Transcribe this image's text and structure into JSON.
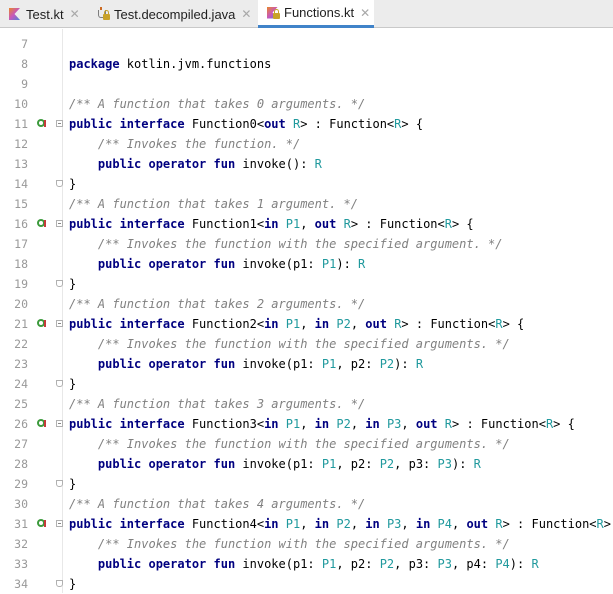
{
  "tabs": [
    {
      "label": "Test.kt",
      "icon": "kotlin-file-icon",
      "active": false
    },
    {
      "label": "Test.decompiled.java",
      "icon": "java-file-icon",
      "active": false
    },
    {
      "label": "Functions.kt",
      "icon": "kotlin-file-icon",
      "active": true
    }
  ],
  "close_glyph": "✕",
  "colors": {
    "keyword": "#000080",
    "comment": "#808080",
    "type_param": "#20999d",
    "gutter_icon": "#3c9a3c",
    "tab_underline": "#4083c9"
  },
  "lines": [
    {
      "n": "7",
      "tokens": []
    },
    {
      "n": "8",
      "tokens": [
        [
          "kw",
          "package"
        ],
        [
          "pl",
          " kotlin.jvm.functions"
        ]
      ]
    },
    {
      "n": "9",
      "tokens": []
    },
    {
      "n": "10",
      "tokens": [
        [
          "cm",
          "/** A function that takes 0 arguments. */"
        ]
      ]
    },
    {
      "n": "11",
      "impl": true,
      "fold": "open",
      "tokens": [
        [
          "kw",
          "public interface"
        ],
        [
          "pl",
          " Function0<"
        ],
        [
          "kw",
          "out"
        ],
        [
          "pl",
          " "
        ],
        [
          "tp",
          "R"
        ],
        [
          "pl",
          "> : Function<"
        ],
        [
          "tp",
          "R"
        ],
        [
          "pl",
          "> {"
        ]
      ]
    },
    {
      "n": "12",
      "tokens": [
        [
          "pl",
          "    "
        ],
        [
          "cm",
          "/** Invokes the function. */"
        ]
      ]
    },
    {
      "n": "13",
      "tokens": [
        [
          "pl",
          "    "
        ],
        [
          "kw",
          "public operator fun"
        ],
        [
          "pl",
          " invoke(): "
        ],
        [
          "tp",
          "R"
        ]
      ]
    },
    {
      "n": "14",
      "fold": "close",
      "tokens": [
        [
          "pl",
          "}"
        ]
      ]
    },
    {
      "n": "15",
      "tokens": [
        [
          "cm",
          "/** A function that takes 1 argument. */"
        ]
      ]
    },
    {
      "n": "16",
      "impl": true,
      "fold": "open",
      "tokens": [
        [
          "kw",
          "public interface"
        ],
        [
          "pl",
          " Function1<"
        ],
        [
          "kw",
          "in"
        ],
        [
          "pl",
          " "
        ],
        [
          "tp",
          "P1"
        ],
        [
          "pl",
          ", "
        ],
        [
          "kw",
          "out"
        ],
        [
          "pl",
          " "
        ],
        [
          "tp",
          "R"
        ],
        [
          "pl",
          "> : Function<"
        ],
        [
          "tp",
          "R"
        ],
        [
          "pl",
          "> {"
        ]
      ]
    },
    {
      "n": "17",
      "tokens": [
        [
          "pl",
          "    "
        ],
        [
          "cm",
          "/** Invokes the function with the specified argument. */"
        ]
      ]
    },
    {
      "n": "18",
      "tokens": [
        [
          "pl",
          "    "
        ],
        [
          "kw",
          "public operator fun"
        ],
        [
          "pl",
          " invoke(p1: "
        ],
        [
          "tp",
          "P1"
        ],
        [
          "pl",
          "): "
        ],
        [
          "tp",
          "R"
        ]
      ]
    },
    {
      "n": "19",
      "fold": "close",
      "tokens": [
        [
          "pl",
          "}"
        ]
      ]
    },
    {
      "n": "20",
      "tokens": [
        [
          "cm",
          "/** A function that takes 2 arguments. */"
        ]
      ]
    },
    {
      "n": "21",
      "impl": true,
      "fold": "open",
      "tokens": [
        [
          "kw",
          "public interface"
        ],
        [
          "pl",
          " Function2<"
        ],
        [
          "kw",
          "in"
        ],
        [
          "pl",
          " "
        ],
        [
          "tp",
          "P1"
        ],
        [
          "pl",
          ", "
        ],
        [
          "kw",
          "in"
        ],
        [
          "pl",
          " "
        ],
        [
          "tp",
          "P2"
        ],
        [
          "pl",
          ", "
        ],
        [
          "kw",
          "out"
        ],
        [
          "pl",
          " "
        ],
        [
          "tp",
          "R"
        ],
        [
          "pl",
          "> : Function<"
        ],
        [
          "tp",
          "R"
        ],
        [
          "pl",
          "> {"
        ]
      ]
    },
    {
      "n": "22",
      "tokens": [
        [
          "pl",
          "    "
        ],
        [
          "cm",
          "/** Invokes the function with the specified arguments. */"
        ]
      ]
    },
    {
      "n": "23",
      "tokens": [
        [
          "pl",
          "    "
        ],
        [
          "kw",
          "public operator fun"
        ],
        [
          "pl",
          " invoke(p1: "
        ],
        [
          "tp",
          "P1"
        ],
        [
          "pl",
          ", p2: "
        ],
        [
          "tp",
          "P2"
        ],
        [
          "pl",
          "): "
        ],
        [
          "tp",
          "R"
        ]
      ]
    },
    {
      "n": "24",
      "fold": "close",
      "tokens": [
        [
          "pl",
          "}"
        ]
      ]
    },
    {
      "n": "25",
      "tokens": [
        [
          "cm",
          "/** A function that takes 3 arguments. */"
        ]
      ]
    },
    {
      "n": "26",
      "impl": true,
      "fold": "open",
      "tokens": [
        [
          "kw",
          "public interface"
        ],
        [
          "pl",
          " Function3<"
        ],
        [
          "kw",
          "in"
        ],
        [
          "pl",
          " "
        ],
        [
          "tp",
          "P1"
        ],
        [
          "pl",
          ", "
        ],
        [
          "kw",
          "in"
        ],
        [
          "pl",
          " "
        ],
        [
          "tp",
          "P2"
        ],
        [
          "pl",
          ", "
        ],
        [
          "kw",
          "in"
        ],
        [
          "pl",
          " "
        ],
        [
          "tp",
          "P3"
        ],
        [
          "pl",
          ", "
        ],
        [
          "kw",
          "out"
        ],
        [
          "pl",
          " "
        ],
        [
          "tp",
          "R"
        ],
        [
          "pl",
          "> : Function<"
        ],
        [
          "tp",
          "R"
        ],
        [
          "pl",
          "> {"
        ]
      ]
    },
    {
      "n": "27",
      "tokens": [
        [
          "pl",
          "    "
        ],
        [
          "cm",
          "/** Invokes the function with the specified arguments. */"
        ]
      ]
    },
    {
      "n": "28",
      "tokens": [
        [
          "pl",
          "    "
        ],
        [
          "kw",
          "public operator fun"
        ],
        [
          "pl",
          " invoke(p1: "
        ],
        [
          "tp",
          "P1"
        ],
        [
          "pl",
          ", p2: "
        ],
        [
          "tp",
          "P2"
        ],
        [
          "pl",
          ", p3: "
        ],
        [
          "tp",
          "P3"
        ],
        [
          "pl",
          "): "
        ],
        [
          "tp",
          "R"
        ]
      ]
    },
    {
      "n": "29",
      "fold": "close",
      "tokens": [
        [
          "pl",
          "}"
        ]
      ]
    },
    {
      "n": "30",
      "tokens": [
        [
          "cm",
          "/** A function that takes 4 arguments. */"
        ]
      ]
    },
    {
      "n": "31",
      "impl": true,
      "fold": "open",
      "tokens": [
        [
          "kw",
          "public interface"
        ],
        [
          "pl",
          " Function4<"
        ],
        [
          "kw",
          "in"
        ],
        [
          "pl",
          " "
        ],
        [
          "tp",
          "P1"
        ],
        [
          "pl",
          ", "
        ],
        [
          "kw",
          "in"
        ],
        [
          "pl",
          " "
        ],
        [
          "tp",
          "P2"
        ],
        [
          "pl",
          ", "
        ],
        [
          "kw",
          "in"
        ],
        [
          "pl",
          " "
        ],
        [
          "tp",
          "P3"
        ],
        [
          "pl",
          ", "
        ],
        [
          "kw",
          "in"
        ],
        [
          "pl",
          " "
        ],
        [
          "tp",
          "P4"
        ],
        [
          "pl",
          ", "
        ],
        [
          "kw",
          "out"
        ],
        [
          "pl",
          " "
        ],
        [
          "tp",
          "R"
        ],
        [
          "pl",
          "> : Function<"
        ],
        [
          "tp",
          "R"
        ],
        [
          "pl",
          "> {"
        ]
      ]
    },
    {
      "n": "32",
      "tokens": [
        [
          "pl",
          "    "
        ],
        [
          "cm",
          "/** Invokes the function with the specified arguments. */"
        ]
      ]
    },
    {
      "n": "33",
      "tokens": [
        [
          "pl",
          "    "
        ],
        [
          "kw",
          "public operator fun"
        ],
        [
          "pl",
          " invoke(p1: "
        ],
        [
          "tp",
          "P1"
        ],
        [
          "pl",
          ", p2: "
        ],
        [
          "tp",
          "P2"
        ],
        [
          "pl",
          ", p3: "
        ],
        [
          "tp",
          "P3"
        ],
        [
          "pl",
          ", p4: "
        ],
        [
          "tp",
          "P4"
        ],
        [
          "pl",
          "): "
        ],
        [
          "tp",
          "R"
        ]
      ]
    },
    {
      "n": "34",
      "fold": "close",
      "tokens": [
        [
          "pl",
          "}"
        ]
      ]
    }
  ]
}
